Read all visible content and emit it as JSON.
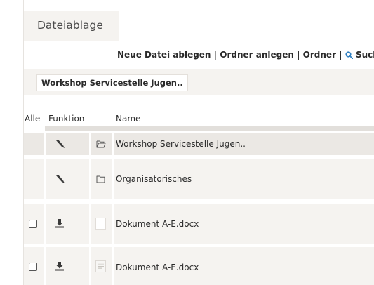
{
  "tab": {
    "title": "Dateiablage"
  },
  "actions": {
    "new_file": "Neue Datei ablegen",
    "new_folder": "Ordner anlegen",
    "folder": "Ordner",
    "search": "Suche",
    "separator": "|"
  },
  "breadcrumb": {
    "current": "Workshop Servicestelle Jugen.."
  },
  "table": {
    "headers": {
      "all": "Alle",
      "function": "Funktion",
      "name": "Name"
    },
    "rows": [
      {
        "name": "Workshop Servicestelle Jugen..",
        "type": "folder-open",
        "action_icon": "pencil-icon",
        "checkbox": false
      },
      {
        "name": "Organisatorisches",
        "type": "folder",
        "action_icon": "pencil-icon",
        "checkbox": false
      },
      {
        "name": "Dokument A-E.docx",
        "type": "document",
        "action_icon": "download-icon",
        "checkbox": true
      },
      {
        "name": "Dokument A-E.docx",
        "type": "document",
        "action_icon": "download-icon",
        "checkbox": true
      }
    ]
  },
  "colors": {
    "panel": "#f5f3f0",
    "highlight_row": "#ebe8e4",
    "search_icon": "#2f7fc1"
  }
}
